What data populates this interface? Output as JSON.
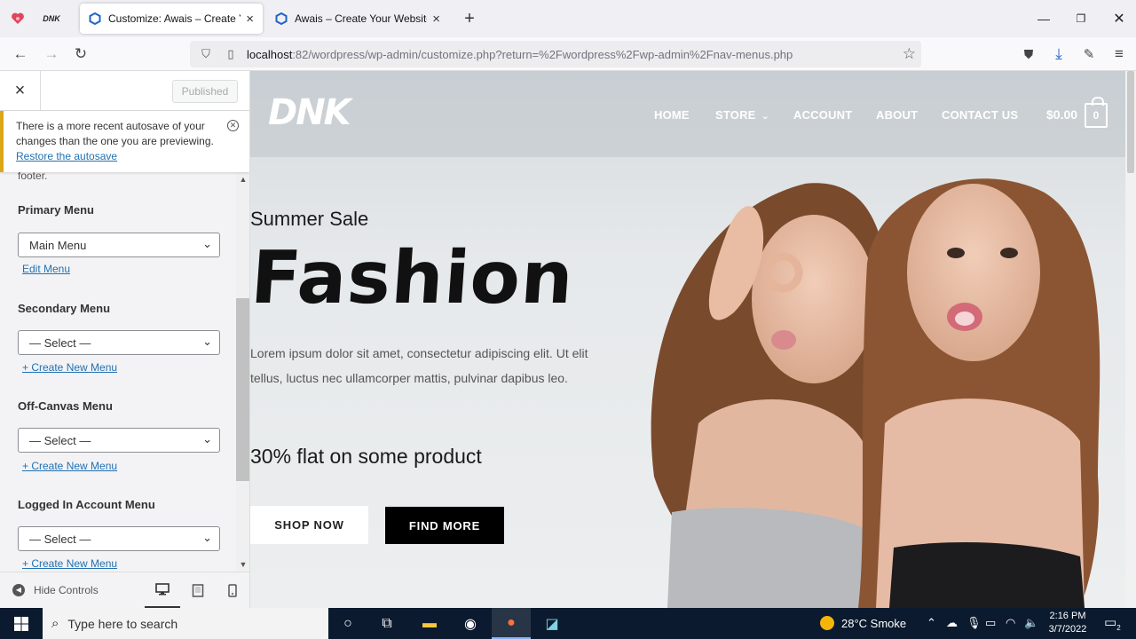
{
  "browser": {
    "tabs": [
      {
        "label": "Customize: Awais – Create Your Website",
        "active": true
      },
      {
        "label": "Awais – Create Your Website",
        "active": false
      }
    ],
    "pinned_icons": [
      "heart-app-icon",
      "dnk-app-icon"
    ],
    "url_host": "localhost",
    "url_path": ":82/wordpress/wp-admin/customize.php?return=%2Fwordpress%2Fwp-admin%2Fnav-menus.php"
  },
  "customizer": {
    "close_label": "×",
    "publish_label": "Published",
    "notice": {
      "text": "There is a more recent autosave of your changes than the one you are previewing.",
      "link": "Restore the autosave"
    },
    "footer_text": "footer.",
    "menus": [
      {
        "label": "Primary Menu",
        "selected": "Main Menu",
        "link": "Edit Menu"
      },
      {
        "label": "Secondary Menu",
        "selected": "— Select —",
        "link": "+ Create New Menu"
      },
      {
        "label": "Off-Canvas Menu",
        "selected": "— Select —",
        "link": "+ Create New Menu"
      },
      {
        "label": "Logged In Account Menu",
        "selected": "— Select —",
        "link": "+ Create New Menu"
      }
    ],
    "hide_controls": "Hide Controls",
    "devices": [
      "desktop-icon",
      "tablet-icon",
      "mobile-icon"
    ],
    "active_device": "desktop"
  },
  "site": {
    "logo": "DNK",
    "nav": [
      "HOME",
      "STORE",
      "ACCOUNT",
      "ABOUT",
      "CONTACT US"
    ],
    "cart_total": "$0.00",
    "cart_count": "0",
    "hero": {
      "eyebrow": "Summer Sale",
      "headline": "Fashion",
      "body": "Lorem ipsum dolor sit amet, consectetur adipiscing elit. Ut elit tellus, luctus nec ullamcorper mattis, pulvinar dapibus leo.",
      "promo": "30% flat on some product",
      "btn_primary": "SHOP NOW",
      "btn_secondary": "FIND MORE"
    }
  },
  "taskbar": {
    "search_placeholder": "Type here to search",
    "weather": "28°C  Smoke",
    "time": "2:16 PM",
    "date": "3/7/2022",
    "notification_count": "2"
  }
}
